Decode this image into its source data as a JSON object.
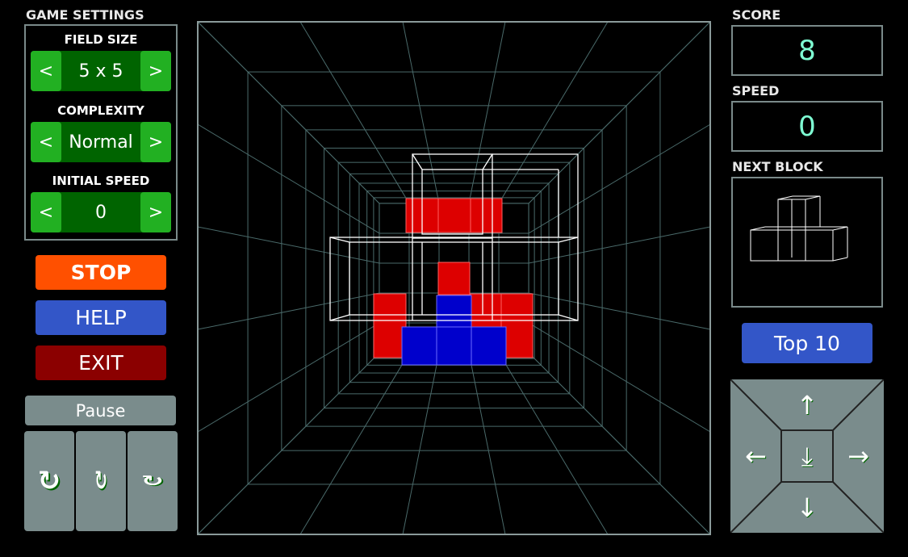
{
  "settings": {
    "title": "GAME SETTINGS",
    "field_size_label": "FIELD SIZE",
    "field_size": "5 x 5",
    "complexity_label": "COMPLEXITY",
    "complexity": "Normal",
    "speed_label": "INITIAL SPEED",
    "speed": "0",
    "prev": "<",
    "next": ">"
  },
  "buttons": {
    "stop": "STOP",
    "help": "HELP",
    "exit": "EXIT",
    "pause": "Pause",
    "top10": "Top 10"
  },
  "rotate": {
    "x": "↻",
    "y": "↻",
    "z": "↻"
  },
  "score": {
    "label": "SCORE",
    "value": "8"
  },
  "speed": {
    "label": "SPEED",
    "value": "0"
  },
  "next_block": {
    "label": "NEXT BLOCK"
  },
  "controls": {
    "up": "↑",
    "down": "↓",
    "left": "←",
    "right": "→",
    "drop": "⤓"
  },
  "colors": {
    "stop": "#ff5000",
    "help": "#3356c8",
    "exit": "#8b0000",
    "stepper_btn": "#22b022",
    "stepper_bg": "#006400",
    "block_red": "#dd0000",
    "block_blue": "#0000cc",
    "grid": "#4a6a6a",
    "score_text": "#7fffd4"
  }
}
